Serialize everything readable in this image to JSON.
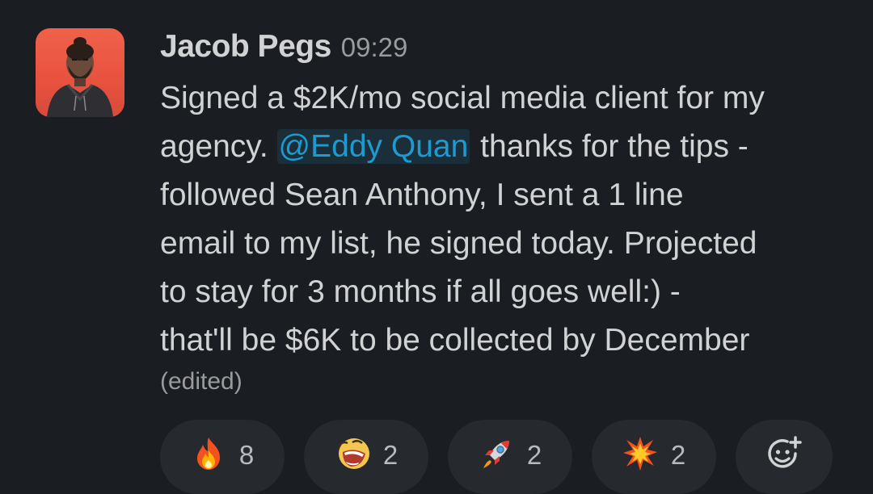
{
  "message": {
    "author": "Jacob Pegs",
    "timestamp": "09:29",
    "lines": [
      "Signed a $2K/mo social media client for my",
      "agency.",
      "@Eddy Quan",
      "thanks for the tips -",
      "followed Sean Anthony, I sent a 1 line",
      "email to my list, he signed today. Projected",
      "to stay for 3 months if all goes well:) -",
      "that'll be $6K to be collected by December"
    ],
    "edited": "(edited)"
  },
  "reactions": [
    {
      "emoji": "fire-emoji",
      "count": "8"
    },
    {
      "emoji": "laughing-face-emoji",
      "count": "2"
    },
    {
      "emoji": "rocket-emoji",
      "count": "2"
    },
    {
      "emoji": "collision-emoji",
      "count": "2"
    }
  ],
  "add_reaction_icon": "add-reaction-icon",
  "colors": {
    "background": "#1a1d21",
    "text": "#d1d2d3",
    "muted": "#9a9b9d",
    "mention": "#1d9bd1",
    "mention_bg": "#1b2f3a",
    "reaction_bg": "#26292d",
    "avatar_bg": "#e8533f"
  }
}
